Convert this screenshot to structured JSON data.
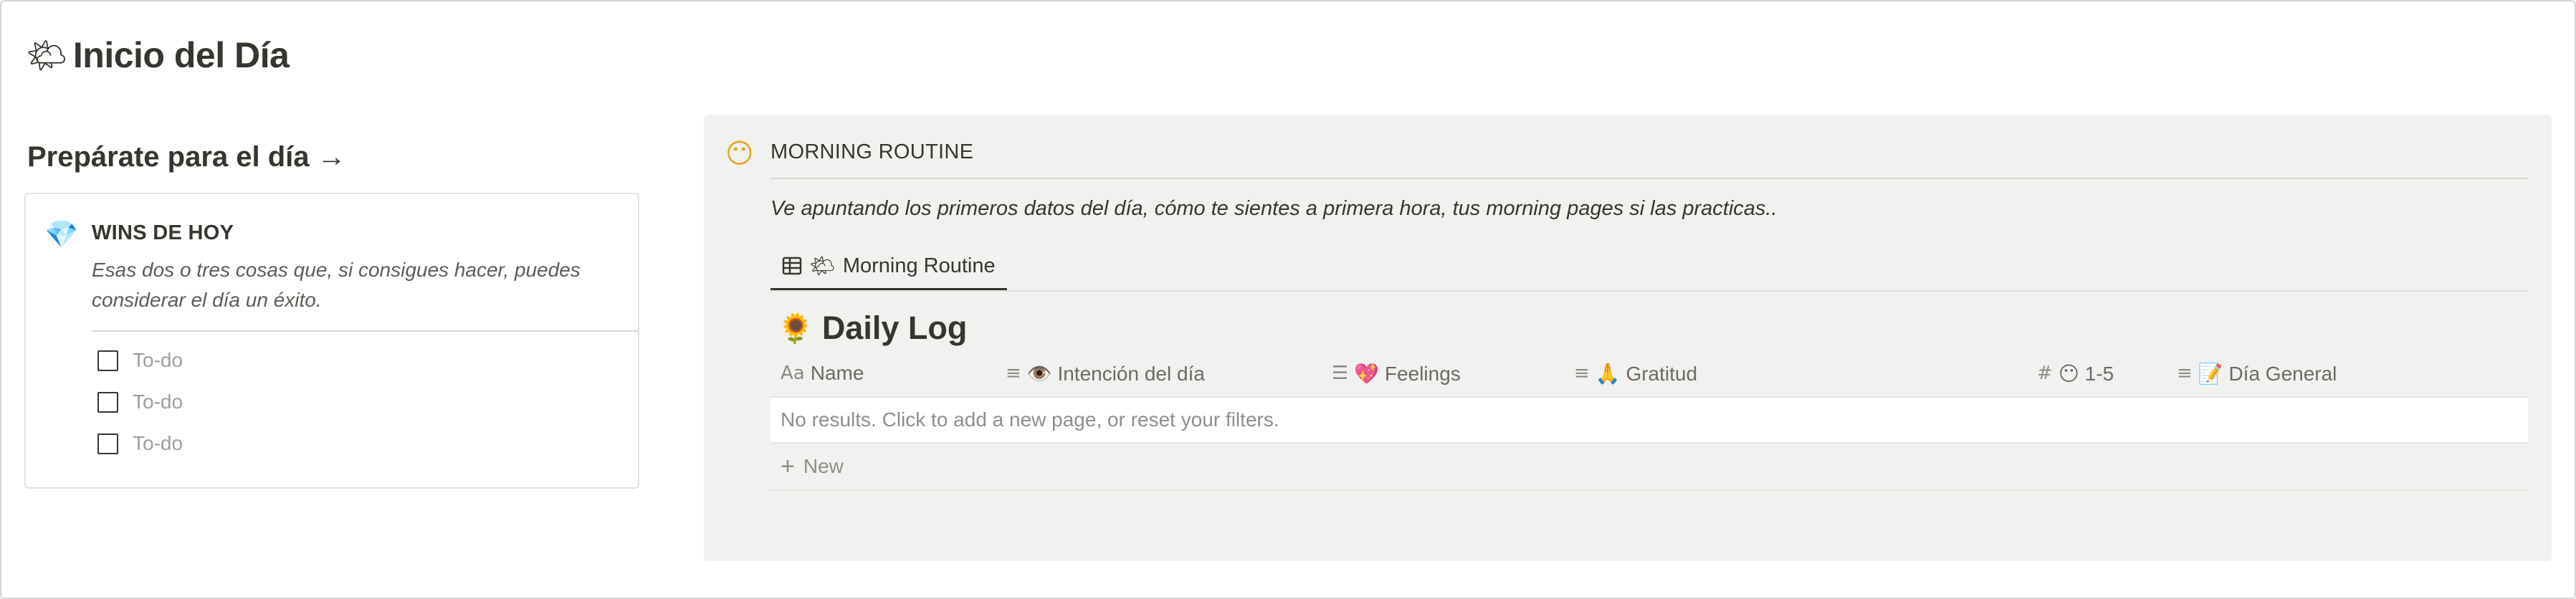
{
  "page": {
    "title_icon": "sun-behind-cloud-icon",
    "title_emoji": "🌤",
    "title": "Inicio del Día"
  },
  "left": {
    "heading": "Prepárate para el día →",
    "wins": {
      "icon": "gem-icon",
      "icon_glyph": "💎",
      "title": "WINS DE HOY",
      "description": "Esas dos o tres cosas que, si consigues hacer, puedes considerar el día un éxito.",
      "todos": [
        {
          "label": "To-do",
          "checked": false
        },
        {
          "label": "To-do",
          "checked": false
        },
        {
          "label": "To-do",
          "checked": false
        }
      ]
    }
  },
  "routine": {
    "icon": "smiling-face-icon",
    "icon_glyph": "😶",
    "title": "MORNING ROUTINE",
    "description": "Ve apuntando los primeros datos del día, cómo te sientes a primera hora, tus morning pages si las practicas..",
    "view_tab": {
      "icon": "table-icon",
      "emoji": "🌤",
      "label": "Morning Routine"
    },
    "database": {
      "emoji": "🌻",
      "title": "Daily Log",
      "columns": [
        {
          "icon": "text-aa-icon",
          "glyph": "Aa",
          "label": "Name"
        },
        {
          "icon": "text-lines-icon",
          "glyph": "≡",
          "label": "👁️ Intención del día"
        },
        {
          "icon": "list-icon",
          "glyph": "☰",
          "label": "💖 Feelings"
        },
        {
          "icon": "text-lines-icon",
          "glyph": "≡",
          "label": "🙏 Gratitud"
        },
        {
          "icon": "hash-icon",
          "glyph": "#",
          "label": "😶 1-5"
        },
        {
          "icon": "text-lines-icon",
          "glyph": "≡",
          "label": "📝 Día General"
        }
      ],
      "empty_message": "No results. Click to add a new page, or reset your filters.",
      "new_label": "New"
    }
  }
}
